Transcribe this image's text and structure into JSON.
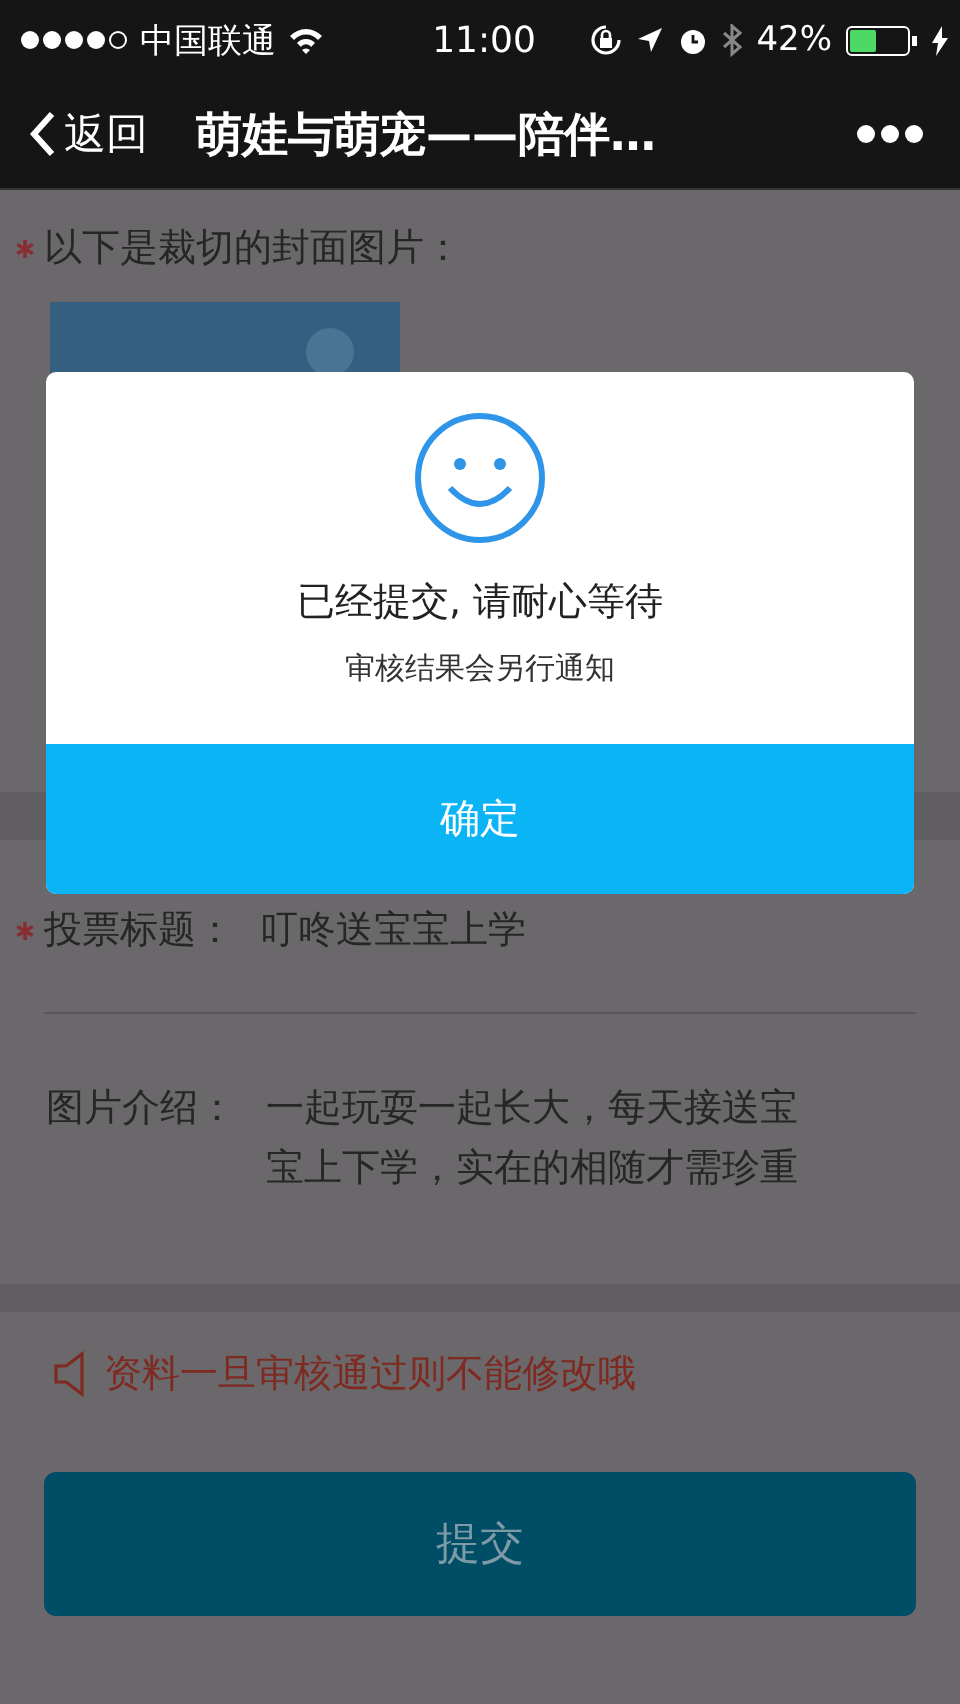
{
  "status_bar": {
    "carrier": "中国联通",
    "time": "11:00",
    "battery": "42%"
  },
  "nav": {
    "back": "返回",
    "title": "萌娃与萌宠——陪伴…"
  },
  "form": {
    "cover_label": "以下是裁切的封面图片：",
    "cover_required": true,
    "vote_title": {
      "label": "投票标题：",
      "value": "叮咚送宝宝上学",
      "required": true
    },
    "intro": {
      "label": "图片介绍：",
      "value": "一起玩耍一起长大，每天接送宝宝上下学，实在的相随才需珍重"
    },
    "notice": "资料一旦审核通过则不能修改哦",
    "submit": "提交"
  },
  "dialog": {
    "message": "已经提交, 请耐心等待",
    "detail": "审核结果会另行通知",
    "confirm": "确定"
  }
}
